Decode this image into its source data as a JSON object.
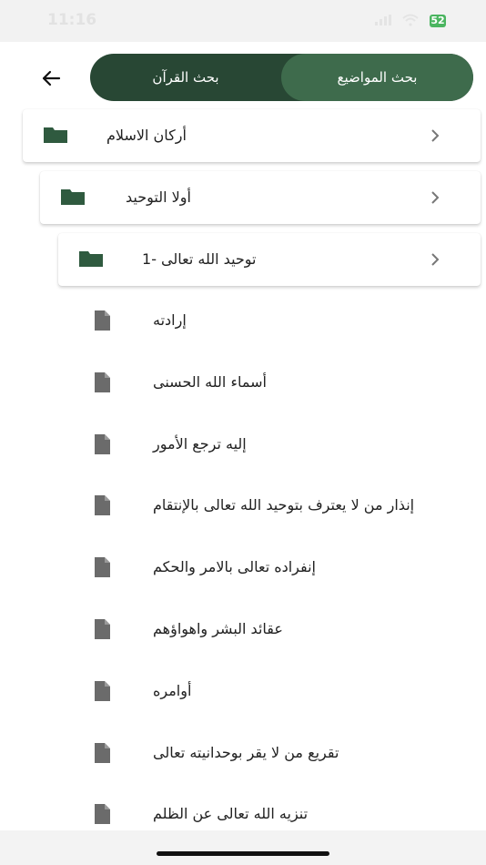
{
  "statusbar": {
    "time": "11:16",
    "battery": "52"
  },
  "header": {
    "tab_topics": "بحث المواضيع",
    "tab_quran": "بحث القرآن"
  },
  "tree": {
    "level1": "أركان الاسلام",
    "level2": "أولا التوحيد",
    "level3": "توحيد الله تعالى -1"
  },
  "files": [
    "إرادته",
    "أسماء الله الحسنى",
    "إليه ترجع الأمور",
    "إنذار من لا يعترف بتوحيد الله تعالى بالإنتقام",
    "إنفراده تعالى بالامر والحكم",
    "عقائد البشر واهواؤهم",
    "أوامره",
    "تقريع من لا يقر بوحدانيته تعالى",
    "تنزيه الله تعالى عن الظلم"
  ],
  "colors": {
    "accent_dark": "#284734",
    "accent_light": "#3e6b4c",
    "folder": "#2f5a3f",
    "file_icon": "#6b6b6b"
  }
}
